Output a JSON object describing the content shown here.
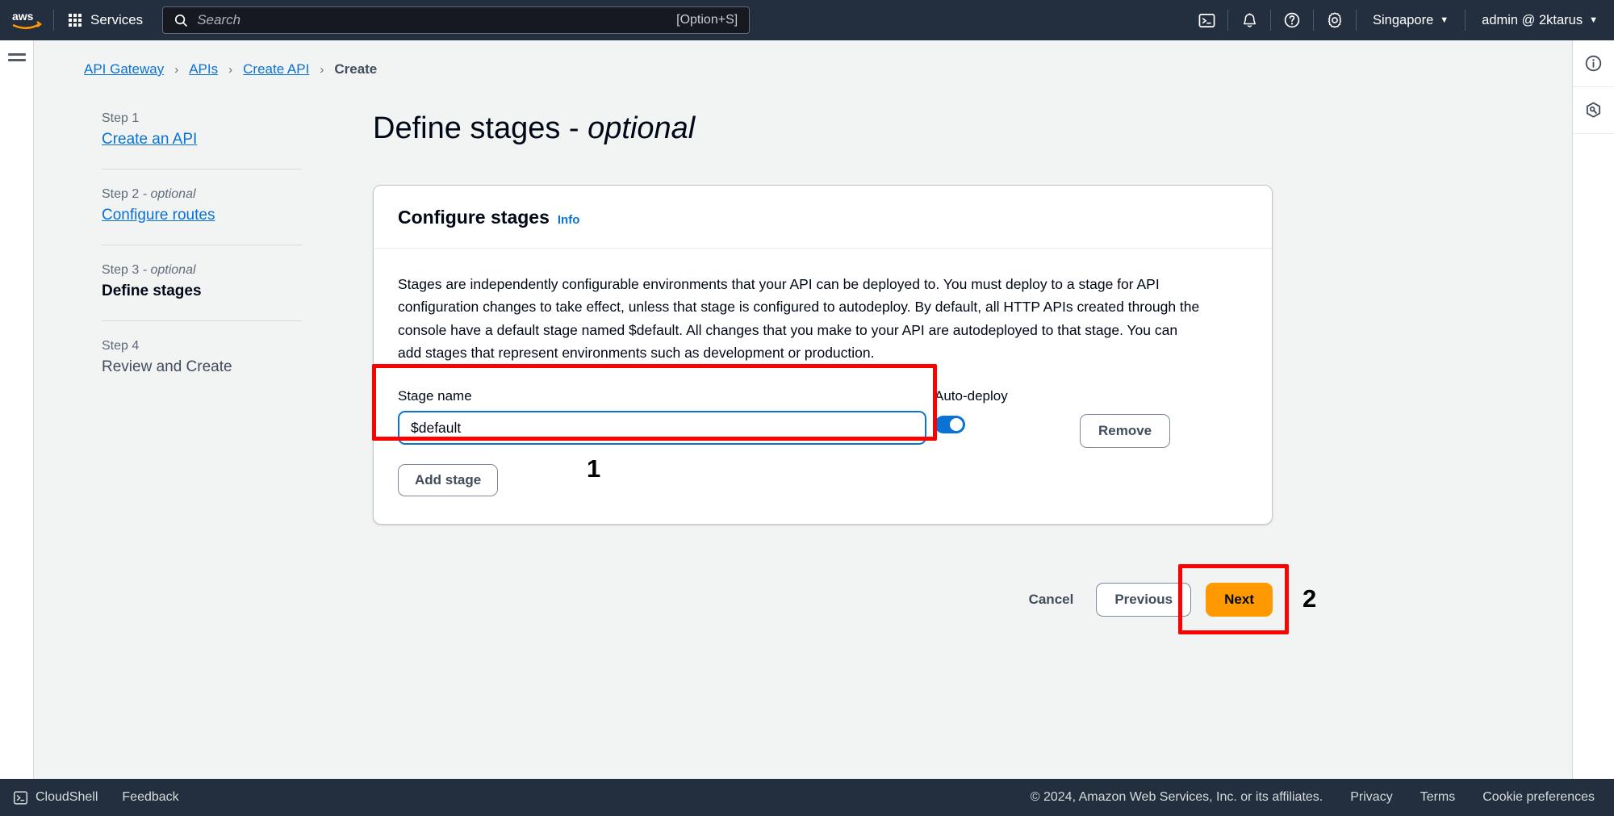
{
  "topnav": {
    "logo_alt": "aws",
    "services_label": "Services",
    "search_placeholder": "Search",
    "search_shortcut": "[Option+S]",
    "region_label": "Singapore",
    "account_label": "admin @ 2ktarus",
    "icons": [
      "cloudshell-icon",
      "bell-icon",
      "help-icon",
      "settings-icon"
    ]
  },
  "breadcrumb": {
    "items": [
      {
        "label": "API Gateway",
        "link": true
      },
      {
        "label": "APIs",
        "link": true
      },
      {
        "label": "Create API",
        "link": true
      },
      {
        "label": "Create",
        "link": false
      }
    ],
    "separator": "›"
  },
  "steps": [
    {
      "label": "Step 1",
      "optional": "",
      "title": "Create an API",
      "state": "link"
    },
    {
      "label": "Step 2",
      "optional": " - optional",
      "title": "Configure routes",
      "state": "link"
    },
    {
      "label": "Step 3",
      "optional": " - optional",
      "title": "Define stages",
      "state": "active"
    },
    {
      "label": "Step 4",
      "optional": "",
      "title": "Review and Create",
      "state": "plain"
    }
  ],
  "page": {
    "title": "Define stages - ",
    "title_emphasis": "optional"
  },
  "card": {
    "heading": "Configure stages",
    "info_label": "Info",
    "description": "Stages are independently configurable environments that your API can be deployed to. You must deploy to a stage for API configuration changes to take effect, unless that stage is configured to autodeploy. By default, all HTTP APIs created through the console have a default stage named $default. All changes that you make to your API are autodeployed to that stage. You can add stages that represent environments such as development or production.",
    "stage_name_label": "Stage name",
    "stage_name_value": "$default",
    "stage_name_placeholder": "Stage name",
    "autodeploy_label": "Auto-deploy",
    "autodeploy_enabled": true,
    "remove_label": "Remove",
    "add_stage_label": "Add stage"
  },
  "actions": {
    "cancel_label": "Cancel",
    "previous_label": "Previous",
    "next_label": "Next"
  },
  "annotations": {
    "marker_one": "1",
    "marker_two": "2",
    "color": "#ff0000"
  },
  "rightrail": {
    "icons": [
      "info-circle-icon",
      "hexagon-tools-icon"
    ]
  },
  "footer": {
    "cloudshell_label": "CloudShell",
    "feedback_label": "Feedback",
    "copyright": "© 2024, Amazon Web Services, Inc. or its affiliates.",
    "privacy_label": "Privacy",
    "terms_label": "Terms",
    "cookie_label": "Cookie preferences"
  },
  "colors": {
    "nav_bg": "#232f3e",
    "accent_blue": "#0972d3",
    "action_orange": "#ff9900",
    "page_bg": "#f2f3f3",
    "annotation_red": "#ff0000"
  }
}
